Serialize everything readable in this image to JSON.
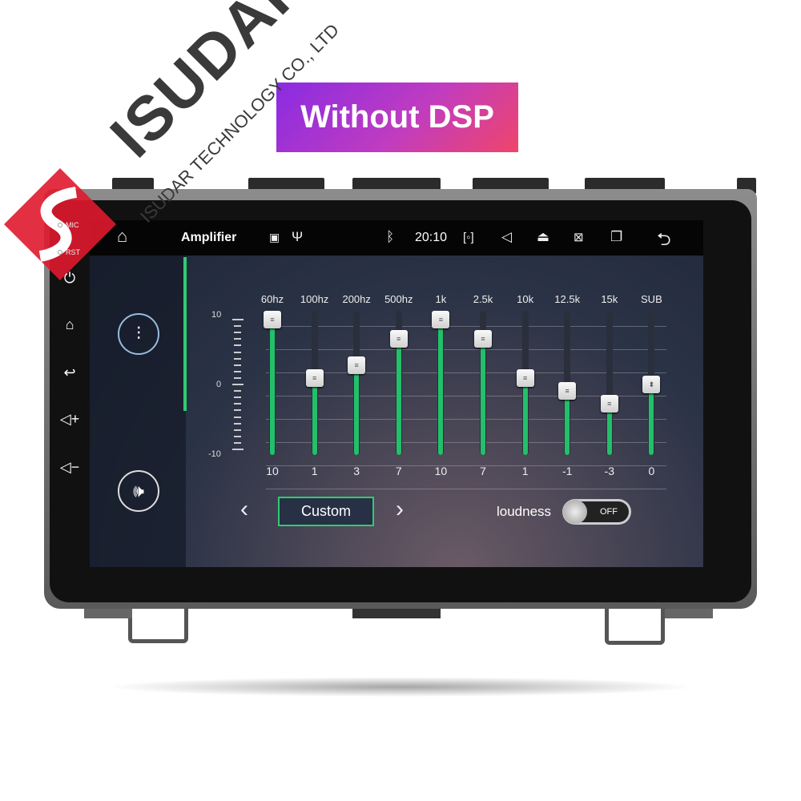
{
  "banner": {
    "text": "Without DSP",
    "colors": [
      "#8a2be2",
      "#f0456a"
    ]
  },
  "brand": {
    "name": "ISUDAR",
    "company": "ISUDAR TECHNOLOGY CO., LTD",
    "logo_color": "#e0182d"
  },
  "device_side": {
    "mic": "MIC",
    "rst": "RST",
    "buttons": [
      "power-icon",
      "home-icon",
      "back-icon",
      "volume-up-icon",
      "volume-down-icon"
    ]
  },
  "status_bar": {
    "title": "Amplifier",
    "time": "20:10",
    "icons": [
      "home-icon",
      "image-icon",
      "usb-icon",
      "bluetooth-icon",
      "camera-icon",
      "speaker-icon",
      "eject-icon",
      "screen-off-icon",
      "recent-apps-icon",
      "back-icon"
    ]
  },
  "equalizer": {
    "scale": {
      "max": "10",
      "mid": "0",
      "min": "-10"
    },
    "range": [
      -10,
      10
    ],
    "accent": "#22c06a",
    "bands": [
      {
        "label": "60hz",
        "value": 10
      },
      {
        "label": "100hz",
        "value": 1
      },
      {
        "label": "200hz",
        "value": 3
      },
      {
        "label": "500hz",
        "value": 7
      },
      {
        "label": "1k",
        "value": 10
      },
      {
        "label": "2.5k",
        "value": 7
      },
      {
        "label": "10k",
        "value": 1
      },
      {
        "label": "12.5k",
        "value": -1
      },
      {
        "label": "15k",
        "value": -3
      },
      {
        "label": "SUB",
        "value": 0
      }
    ],
    "preset": "Custom",
    "loudness_label": "loudness",
    "loudness_state": "OFF"
  }
}
